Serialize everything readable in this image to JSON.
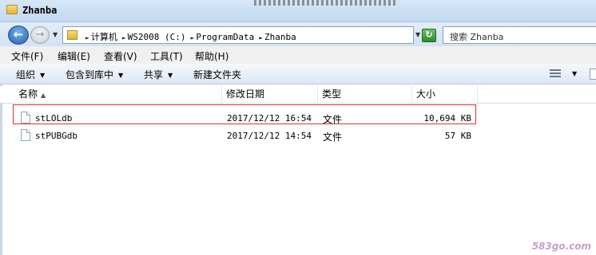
{
  "window": {
    "title": "Zhanba"
  },
  "address": {
    "crumbs": [
      "计算机",
      "WS2008 (C:)",
      "ProgramData",
      "Zhanba"
    ]
  },
  "search": {
    "placeholder": "搜索 Zhanba"
  },
  "menu": [
    {
      "label": "文件(F)"
    },
    {
      "label": "编辑(E)"
    },
    {
      "label": "查看(V)"
    },
    {
      "label": "工具(T)"
    },
    {
      "label": "帮助(H)"
    }
  ],
  "commands": [
    {
      "label": "组织",
      "has_dropdown": true
    },
    {
      "label": "包含到库中",
      "has_dropdown": true
    },
    {
      "label": "共享",
      "has_dropdown": true
    },
    {
      "label": "新建文件夹",
      "has_dropdown": false
    }
  ],
  "columns": [
    {
      "label": "名称"
    },
    {
      "label": "修改日期"
    },
    {
      "label": "类型"
    },
    {
      "label": "大小"
    }
  ],
  "files": [
    {
      "name": "stLOLdb",
      "modified": "2017/12/12 16:54",
      "type": "文件",
      "size": "10,694 KB",
      "highlighted": true
    },
    {
      "name": "stPUBGdb",
      "modified": "2017/12/12 14:54",
      "type": "文件",
      "size": "57 KB",
      "highlighted": false
    }
  ],
  "watermark": {
    "text": "583go.com"
  },
  "colors": {
    "highlight_border": "#e0313a",
    "titlebar": "#c3d9f0"
  }
}
